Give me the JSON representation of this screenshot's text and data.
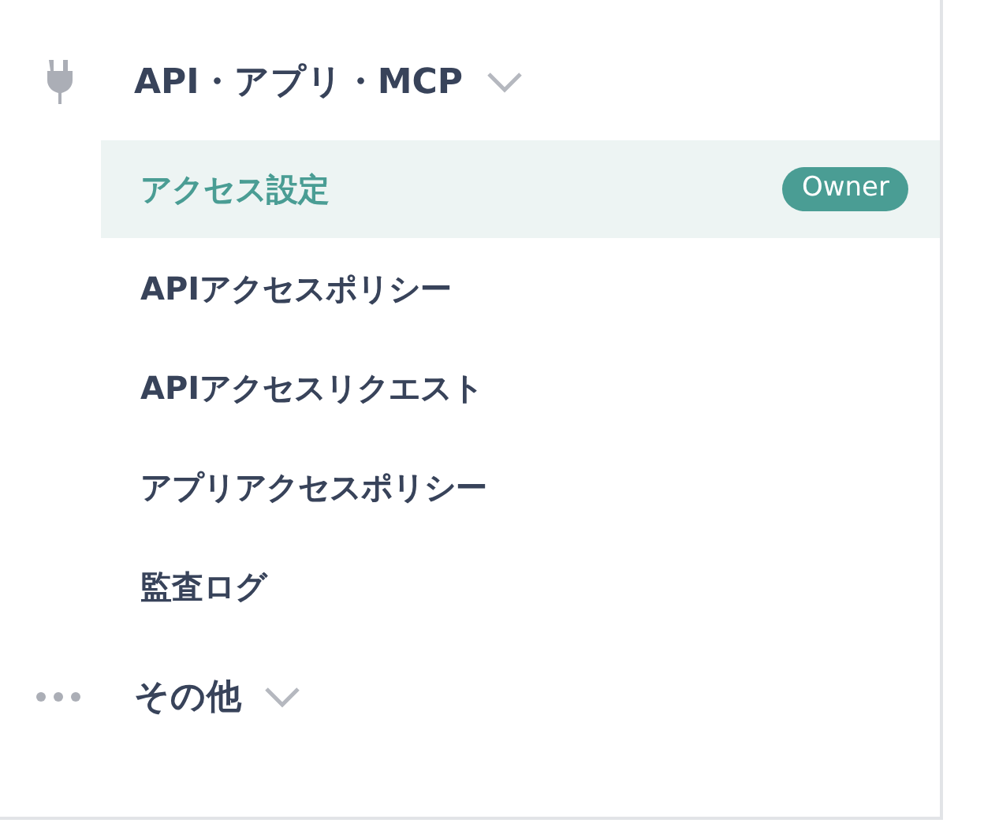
{
  "sections": [
    {
      "kind": "plug",
      "label": "API・アプリ・MCP",
      "items": [
        {
          "label": "アクセス設定",
          "selected": true,
          "badge": "Owner"
        },
        {
          "label": "APIアクセスポリシー",
          "selected": false
        },
        {
          "label": "APIアクセスリクエスト",
          "selected": false
        },
        {
          "label": "アプリアクセスポリシー",
          "selected": false
        },
        {
          "label": "監査ログ",
          "selected": false
        }
      ]
    },
    {
      "kind": "dots",
      "label": "その他"
    }
  ]
}
